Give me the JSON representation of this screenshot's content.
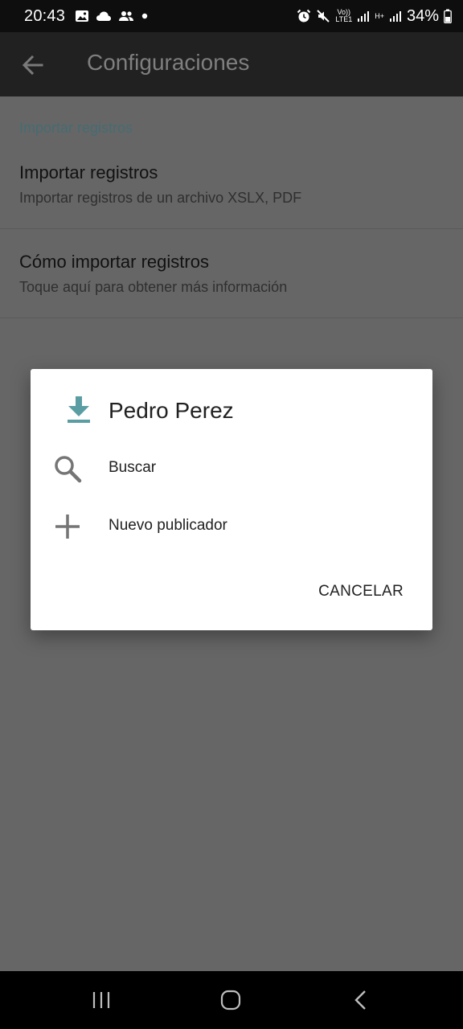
{
  "status_bar": {
    "time": "20:43",
    "network_top": "Vo))",
    "network_bottom": "LTE1",
    "network2": "H+",
    "battery": "34%",
    "icons_left": [
      "image-icon",
      "cloud-icon",
      "people-icon",
      "dot-icon"
    ],
    "icons_right": [
      "alarm-icon",
      "mute-icon",
      "signal-icon",
      "signal-icon",
      "battery-icon"
    ]
  },
  "app_bar": {
    "title": "Configuraciones",
    "back_icon": "arrow-back-icon"
  },
  "settings": {
    "section_header": "Importar registros",
    "items": [
      {
        "title": "Importar registros",
        "summary": "Importar registros de un archivo XSLX, PDF"
      },
      {
        "title": "Cómo importar registros",
        "summary": "Toque aquí para obtener más información"
      }
    ]
  },
  "dialog": {
    "title": "Pedro Perez",
    "title_icon": "download-icon",
    "options": [
      {
        "label": "Buscar",
        "icon": "search-icon"
      },
      {
        "label": "Nuevo publicador",
        "icon": "plus-icon"
      }
    ],
    "cancel_label": "CANCELAR"
  },
  "colors": {
    "accent": "#5a9ea4",
    "app_bar": "#212121",
    "scrim_background": "#666666",
    "dialog_bg": "#ffffff"
  }
}
